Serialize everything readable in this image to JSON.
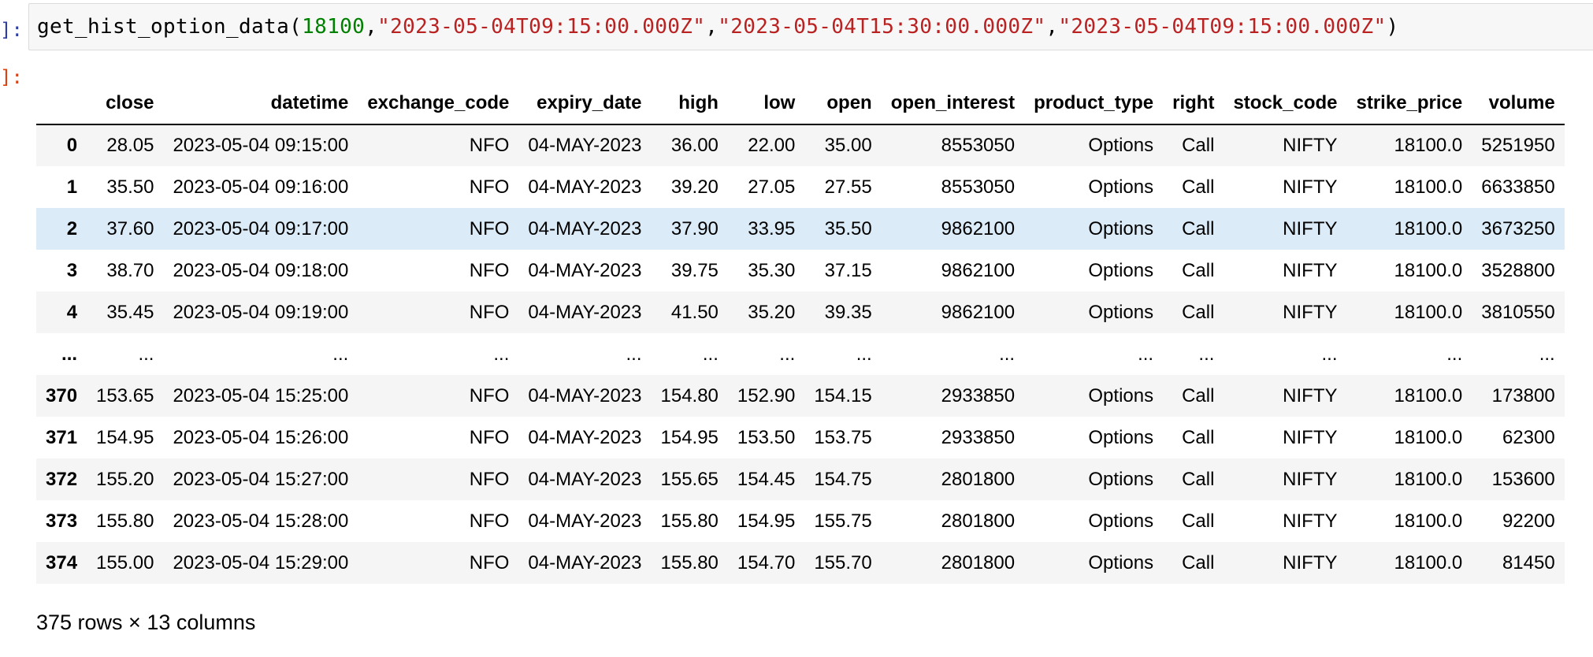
{
  "prompt_in": "]:",
  "prompt_out": "]:",
  "code": {
    "function_name": "get_hist_option_data",
    "open_paren": "(",
    "arg_strike": "18100",
    "comma1": ",",
    "arg_from": "\"2023-05-04T09:15:00.000Z\"",
    "comma2": ",",
    "arg_to": "\"2023-05-04T15:30:00.000Z\"",
    "comma3": ",",
    "arg_expiry": "\"2023-05-04T09:15:00.000Z\"",
    "close_paren": ")"
  },
  "table": {
    "index_header": "",
    "columns": [
      "close",
      "datetime",
      "exchange_code",
      "expiry_date",
      "high",
      "low",
      "open",
      "open_interest",
      "product_type",
      "right",
      "stock_code",
      "strike_price",
      "volume"
    ],
    "rows": [
      {
        "index": "0",
        "cells": [
          "28.05",
          "2023-05-04 09:15:00",
          "NFO",
          "04-MAY-2023",
          "36.00",
          "22.00",
          "35.00",
          "8553050",
          "Options",
          "Call",
          "NIFTY",
          "18100.0",
          "5251950"
        ]
      },
      {
        "index": "1",
        "cells": [
          "35.50",
          "2023-05-04 09:16:00",
          "NFO",
          "04-MAY-2023",
          "39.20",
          "27.05",
          "27.55",
          "8553050",
          "Options",
          "Call",
          "NIFTY",
          "18100.0",
          "6633850"
        ]
      },
      {
        "index": "2",
        "cells": [
          "37.60",
          "2023-05-04 09:17:00",
          "NFO",
          "04-MAY-2023",
          "37.90",
          "33.95",
          "35.50",
          "9862100",
          "Options",
          "Call",
          "NIFTY",
          "18100.0",
          "3673250"
        ]
      },
      {
        "index": "3",
        "cells": [
          "38.70",
          "2023-05-04 09:18:00",
          "NFO",
          "04-MAY-2023",
          "39.75",
          "35.30",
          "37.15",
          "9862100",
          "Options",
          "Call",
          "NIFTY",
          "18100.0",
          "3528800"
        ]
      },
      {
        "index": "4",
        "cells": [
          "35.45",
          "2023-05-04 09:19:00",
          "NFO",
          "04-MAY-2023",
          "41.50",
          "35.20",
          "39.35",
          "9862100",
          "Options",
          "Call",
          "NIFTY",
          "18100.0",
          "3810550"
        ]
      },
      {
        "index": "...",
        "cells": [
          "...",
          "...",
          "...",
          "...",
          "...",
          "...",
          "...",
          "...",
          "...",
          "...",
          "...",
          "...",
          "..."
        ]
      },
      {
        "index": "370",
        "cells": [
          "153.65",
          "2023-05-04 15:25:00",
          "NFO",
          "04-MAY-2023",
          "154.80",
          "152.90",
          "154.15",
          "2933850",
          "Options",
          "Call",
          "NIFTY",
          "18100.0",
          "173800"
        ]
      },
      {
        "index": "371",
        "cells": [
          "154.95",
          "2023-05-04 15:26:00",
          "NFO",
          "04-MAY-2023",
          "154.95",
          "153.50",
          "153.75",
          "2933850",
          "Options",
          "Call",
          "NIFTY",
          "18100.0",
          "62300"
        ]
      },
      {
        "index": "372",
        "cells": [
          "155.20",
          "2023-05-04 15:27:00",
          "NFO",
          "04-MAY-2023",
          "155.65",
          "154.45",
          "154.75",
          "2801800",
          "Options",
          "Call",
          "NIFTY",
          "18100.0",
          "153600"
        ]
      },
      {
        "index": "373",
        "cells": [
          "155.80",
          "2023-05-04 15:28:00",
          "NFO",
          "04-MAY-2023",
          "155.80",
          "154.95",
          "155.75",
          "2801800",
          "Options",
          "Call",
          "NIFTY",
          "18100.0",
          "92200"
        ]
      },
      {
        "index": "374",
        "cells": [
          "155.00",
          "2023-05-04 15:29:00",
          "NFO",
          "04-MAY-2023",
          "155.80",
          "154.70",
          "155.70",
          "2801800",
          "Options",
          "Call",
          "NIFTY",
          "18100.0",
          "81450"
        ]
      }
    ],
    "summary": "375 rows × 13 columns"
  },
  "colors": {
    "prompt_in": "#303f9f",
    "prompt_out": "#d84315",
    "code_number": "#008000",
    "code_string": "#ba2121",
    "row_stripe": "#f5f5f5",
    "row_hover": "#dcebf8"
  }
}
